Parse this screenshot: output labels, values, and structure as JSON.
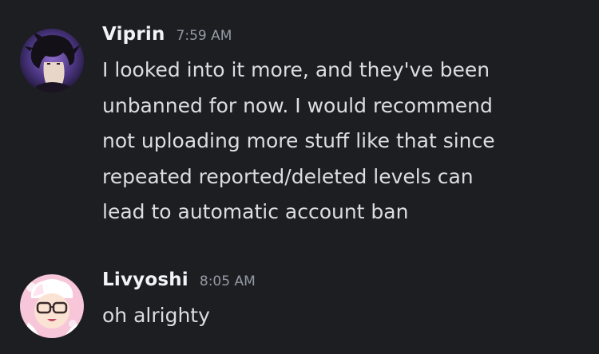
{
  "messages": [
    {
      "username": "Viprin",
      "time": "7:59 AM",
      "text": "I looked into it more, and they've been\nunbanned for now. I would recommend\nnot uploading more stuff like that since\nrepeated reported/deleted levels can\nlead to automatic account ban",
      "avatar": "viprin-avatar"
    },
    {
      "username": "Livyoshi",
      "time": "8:05 AM",
      "text": "oh alrighty",
      "avatar": "livyoshi-avatar"
    }
  ],
  "colors": {
    "background": "#1d1e22",
    "username": "#f2f3f5",
    "timestamp": "#949ba4",
    "message_text": "#dbdee1"
  }
}
